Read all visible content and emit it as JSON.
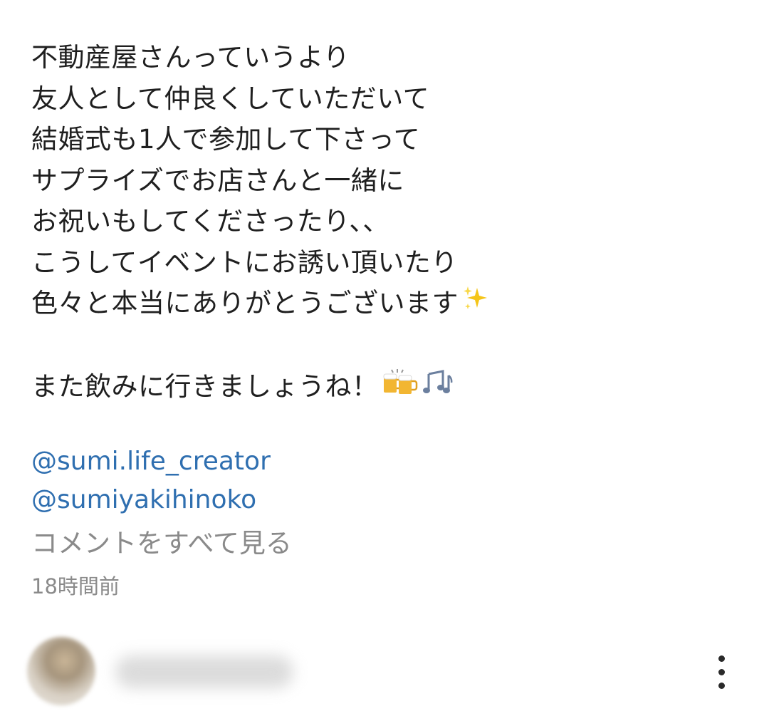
{
  "post": {
    "caption_lines": [
      "不動産屋さんっていうより",
      "友人として仲良くしていただいて",
      "結婚式も1人で参加して下さって",
      "サプライズでお店さんと一緒に",
      "お祝いもしてくださったり、、",
      "こうしてイベントにお誘い頂いたり",
      "色々と本当にありがとうございます"
    ],
    "sparkles_emoji": "✨",
    "closing_line": "また飲みに行きましょうね！",
    "closing_emojis": "🍻🎶",
    "mentions": [
      "@sumi.life_creator",
      "@sumiyakihinoko"
    ],
    "view_all_comments": "コメントをすべて見る",
    "timestamp": "18時間前"
  },
  "colors": {
    "text": "#1f1f1f",
    "mention": "#2f6fb0",
    "muted": "#8a8a8a",
    "background": "#ffffff"
  },
  "comment": {
    "more_icon": "more-vertical-icon"
  }
}
